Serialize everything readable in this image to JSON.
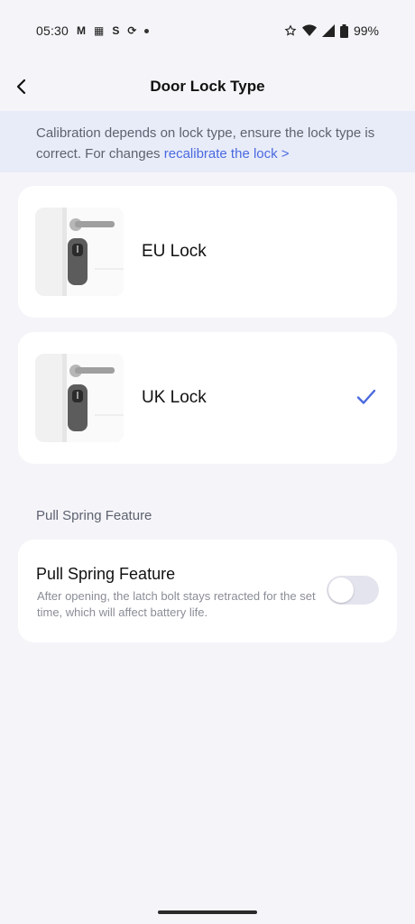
{
  "status": {
    "time": "05:30",
    "left_icons": [
      "gmail-icon",
      "calendar-icon",
      "s-app-icon",
      "sync-icon"
    ],
    "left_glyphs": {
      "gmail": "M",
      "calendar": "▦",
      "s_app": "S",
      "sync": "⟳"
    },
    "right_icons": [
      "star-icon",
      "wifi-icon",
      "signal-icon",
      "battery-icon"
    ],
    "battery": "99%"
  },
  "header": {
    "title": "Door Lock Type"
  },
  "notice": {
    "text": "Calibration depends on lock type, ensure the lock type is correct. For changes ",
    "link": "recalibrate the lock >"
  },
  "lock_options": [
    {
      "label": "EU Lock",
      "selected": false
    },
    {
      "label": "UK Lock",
      "selected": true
    }
  ],
  "pull_spring": {
    "section_label": "Pull Spring Feature",
    "title": "Pull Spring Feature",
    "description": "After opening, the latch bolt stays retracted for the set time, which will affect battery life.",
    "enabled": false
  },
  "colors": {
    "accent": "#4a69e0",
    "background": "#f5f5f9",
    "notice_bg": "#e8ecf8"
  }
}
